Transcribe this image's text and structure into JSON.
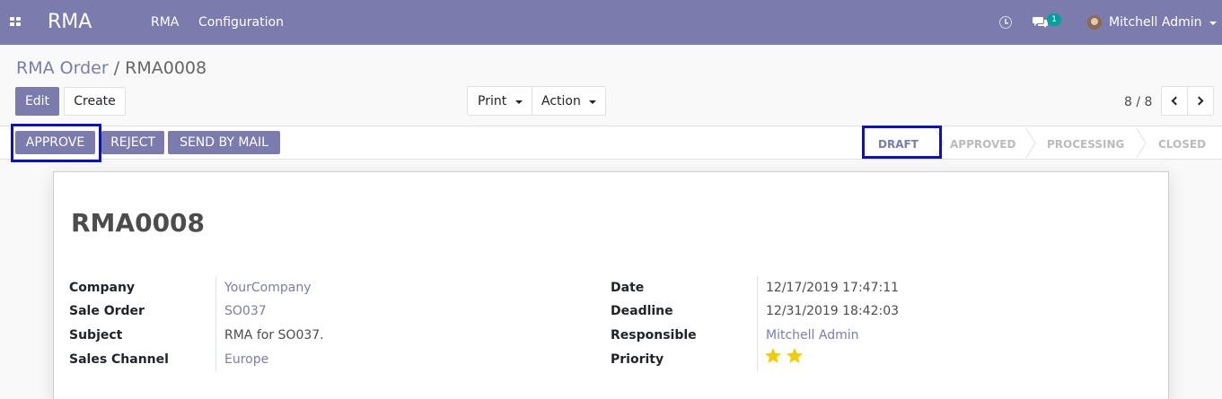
{
  "navbar": {
    "brand": "RMA",
    "menu": [
      "RMA",
      "Configuration"
    ],
    "notification_count": "1",
    "user_name": "Mitchell Admin",
    "color": "#7c7bad"
  },
  "control_panel": {
    "breadcrumb_parent": "RMA Order",
    "breadcrumb_separator": "/",
    "breadcrumb_current": "RMA0008",
    "edit_label": "Edit",
    "create_label": "Create",
    "print_label": "Print",
    "action_label": "Action",
    "pager_value": "8 / 8"
  },
  "statusbar": {
    "buttons": [
      "APPROVE",
      "REJECT",
      "SEND BY MAIL"
    ],
    "stages": [
      "DRAFT",
      "APPROVED",
      "PROCESSING",
      "CLOSED"
    ],
    "active_stage": "DRAFT",
    "highlight_color": "#0a10c8"
  },
  "form": {
    "title": "RMA0008",
    "left_fields": [
      {
        "label": "Company",
        "value": "YourCompany",
        "link": true
      },
      {
        "label": "Sale Order",
        "value": "SO037",
        "link": true
      },
      {
        "label": "Subject",
        "value": "RMA for SO037.",
        "link": false
      },
      {
        "label": "Sales Channel",
        "value": "Europe",
        "link": true
      }
    ],
    "right_fields": [
      {
        "label": "Date",
        "value": "12/17/2019 17:47:11",
        "link": false
      },
      {
        "label": "Deadline",
        "value": "12/31/2019 18:42:03",
        "link": false
      },
      {
        "label": "Responsible",
        "value": "Mitchell Admin",
        "link": true
      },
      {
        "label": "Priority",
        "value": "",
        "link": false
      }
    ],
    "priority_stars": 2,
    "star_color": "#f3cc00"
  }
}
